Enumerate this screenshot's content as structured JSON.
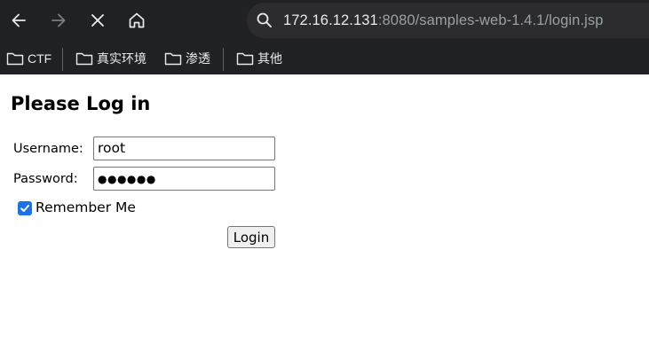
{
  "browser": {
    "url_host": "172.16.12.131",
    "url_rest": ":8080/samples-web-1.4.1/login.jsp",
    "nav": {
      "back_icon": "arrow-left-icon",
      "forward_icon": "arrow-right-icon",
      "stop_icon": "close-icon",
      "home_icon": "home-icon",
      "search_icon": "search-icon"
    },
    "bookmarks": [
      {
        "label": "CTF",
        "icon": "folder-icon"
      },
      {
        "label": "真实环境",
        "icon": "folder-icon"
      },
      {
        "label": "渗透",
        "icon": "folder-icon"
      },
      {
        "label": "其他",
        "icon": "folder-icon"
      }
    ]
  },
  "page": {
    "title": "Please Log in",
    "username_label": "Username:",
    "username_value": "root",
    "password_label": "Password:",
    "password_value": "●●●●●●",
    "remember_label": "Remember Me",
    "remember_checked": true,
    "login_button": "Login"
  },
  "colors": {
    "toolbar_bg": "#202124",
    "checkbox_accent": "#1a73e8"
  }
}
